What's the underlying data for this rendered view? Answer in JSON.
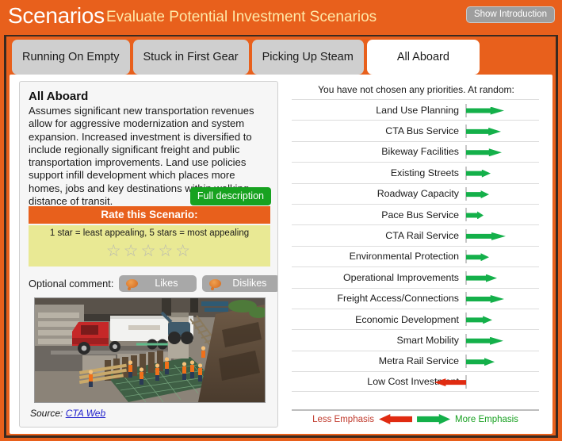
{
  "header": {
    "title": "Scenarios",
    "subtitle": "Evaluate Potential Investment Scenarios",
    "show_intro_label": "Show Introduction",
    "accent_color": "#E8601C",
    "subtitle_color": "#FFE9A8"
  },
  "tabs": [
    {
      "label": "Running On Empty",
      "active": false
    },
    {
      "label": "Stuck in First Gear",
      "active": false
    },
    {
      "label": "Picking Up Steam",
      "active": false
    },
    {
      "label": "All Aboard",
      "active": true
    }
  ],
  "scenario": {
    "title": "All Aboard",
    "description": "Assumes significant new transportation revenues allow for aggressive modernization and system expansion. Increased investment is diversified to include regionally significant freight and public transportation improvements. Land use policies support infill development which places more homes, jobs and key destinations within walking distance of transit.",
    "full_description_label": "Full description",
    "rate_bar_label": "Rate this Scenario:",
    "rate_hint": "1 star = least appealing, 5 stars = most appealing",
    "stars": {
      "total": 5,
      "selected": 0,
      "glyph": "☆",
      "color": "#B8B8B0"
    },
    "comment_label": "Optional comment:",
    "likes_label": "Likes",
    "dislikes_label": "Dislikes",
    "source_prefix": "Source:",
    "source_link_text": "CTA Web"
  },
  "priorities": {
    "note": "You have not chosen any priorities. At random:",
    "green_color": "#14B04A",
    "red_color": "#E02B11",
    "items": [
      {
        "label": "Land Use Planning",
        "direction": "right",
        "length": 48
      },
      {
        "label": "CTA Bus Service",
        "direction": "right",
        "length": 44
      },
      {
        "label": "Bikeway Facilities",
        "direction": "right",
        "length": 45
      },
      {
        "label": "Existing Streets",
        "direction": "right",
        "length": 31
      },
      {
        "label": "Roadway Capacity",
        "direction": "right",
        "length": 29
      },
      {
        "label": "Pace Bus Service",
        "direction": "right",
        "length": 22
      },
      {
        "label": "CTA Rail Service",
        "direction": "right",
        "length": 50
      },
      {
        "label": "Environmental Protection",
        "direction": "right",
        "length": 29
      },
      {
        "label": "Operational Improvements",
        "direction": "right",
        "length": 39
      },
      {
        "label": "Freight Access/Connections",
        "direction": "right",
        "length": 48
      },
      {
        "label": "Economic Development",
        "direction": "right",
        "length": 33
      },
      {
        "label": "Smart Mobility",
        "direction": "right",
        "length": 47
      },
      {
        "label": "Metra Rail Service",
        "direction": "right",
        "length": 36
      },
      {
        "label": "Low Cost Investment",
        "direction": "left",
        "length": 40
      }
    ]
  },
  "legend": {
    "less_label": "Less Emphasis",
    "more_label": "More Emphasis",
    "less_color": "#C0392B",
    "more_color": "#17A020"
  }
}
